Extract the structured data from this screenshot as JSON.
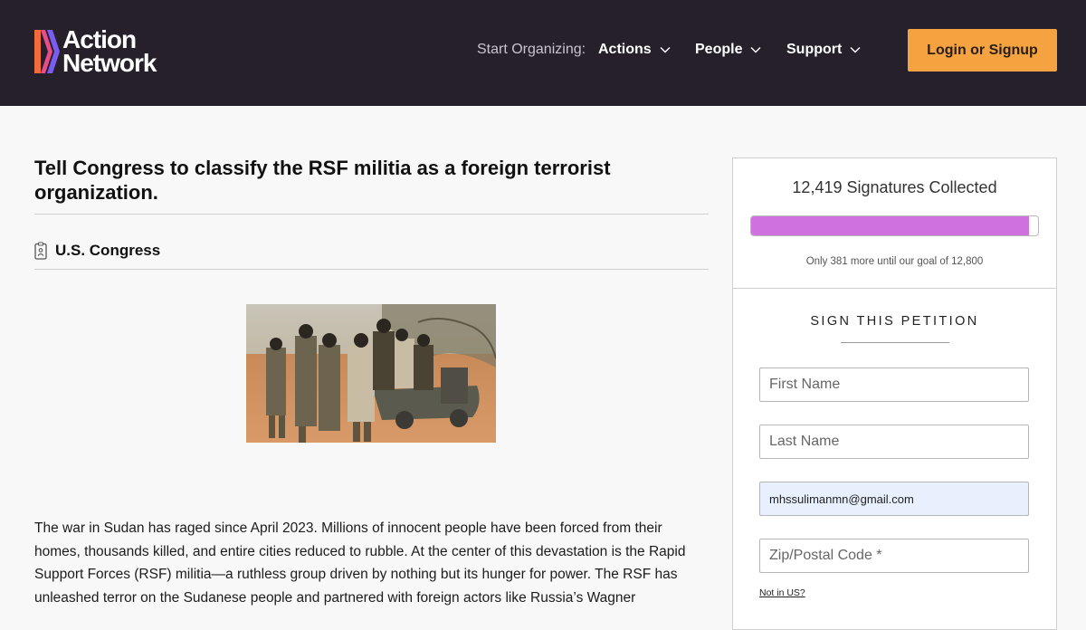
{
  "header": {
    "logo_line1": "Action",
    "logo_line2": "Network",
    "nav_prefix": "Start Organizing:",
    "nav_items": [
      "Actions",
      "People",
      "Support"
    ],
    "login_label": "Login or Signup"
  },
  "petition": {
    "title": "Tell Congress to classify the RSF militia as a foreign terrorist organization.",
    "target": "U.S. Congress",
    "body": "The war in Sudan has raged since April 2023. Millions of innocent people have been forced from their homes, thousands killed, and entire cities reduced to rubble. At the center of this devastation is the Rapid Support Forces (RSF) militia—a ruthless group driven by nothing but its hunger for power. The RSF has unleashed terror on the Sudanese people and partnered with foreign actors like Russia’s Wagner"
  },
  "signatures": {
    "collected_text": "12,419 Signatures Collected",
    "collected": 12419,
    "goal": 12800,
    "progress_fraction": 0.97,
    "remaining_text": "Only 381 more until our goal of 12,800"
  },
  "form": {
    "heading": "SIGN THIS PETITION",
    "first_name_placeholder": "First Name",
    "last_name_placeholder": "Last Name",
    "email_value": "mhssulimanmn@gmail.com",
    "zip_placeholder": "Zip/Postal Code *",
    "not_us_link": "Not in US?"
  },
  "colors": {
    "header_bg": "#25202a",
    "login_button": "#f4a340",
    "progress_fill": "#cf72e0"
  }
}
